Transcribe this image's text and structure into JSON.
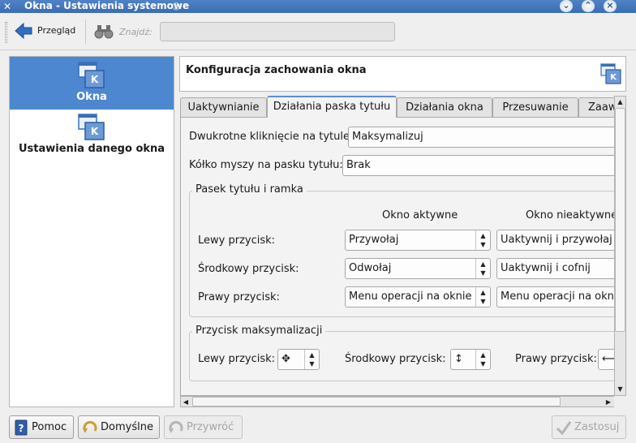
{
  "window": {
    "title": "Okna - Ustawienia systemowe"
  },
  "toolbar": {
    "back_label": "Przegląd",
    "find_label": "Znajdź:",
    "find_value": ""
  },
  "sidebar": {
    "items": [
      {
        "label": "Okna",
        "icon": "window-settings-icon"
      },
      {
        "label": "Ustawienia danego okna",
        "icon": "window-specific-icon"
      }
    ]
  },
  "header": {
    "title": "Konfiguracja zachowania okna"
  },
  "tabs": [
    {
      "label": "Uaktywnianie",
      "active": false
    },
    {
      "label": "Działania paska tytułu",
      "active": true
    },
    {
      "label": "Działania okna",
      "active": false
    },
    {
      "label": "Przesuwanie",
      "active": false
    },
    {
      "label": "Zaaw",
      "active": false
    }
  ],
  "titlebar_actions": {
    "double_click_label": "Dwukrotne kliknięcie na tytule:",
    "double_click_value": "Maksymalizuj",
    "wheel_label": "Kółko myszy na pasku tytułu:",
    "wheel_value": "Brak"
  },
  "titlebar_frame_group": {
    "title": "Pasek tytułu i ramka",
    "col_active": "Okno aktywne",
    "col_inactive": "Okno nieaktywne",
    "rows": [
      {
        "label": "Lewy przycisk:",
        "active": "Przywołaj",
        "inactive": "Uaktywnij i przywołaj"
      },
      {
        "label": "Środkowy przycisk:",
        "active": "Odwołaj",
        "inactive": "Uaktywnij i cofnij"
      },
      {
        "label": "Prawy przycisk:",
        "active": "Menu operacji na oknie",
        "inactive": "Menu operacji na oknie"
      }
    ]
  },
  "maximize_group": {
    "title": "Przycisk maksymalizacji",
    "left_label": "Lewy przycisk:",
    "left_value": "✥",
    "middle_label": "Środkowy przycisk:",
    "middle_value": "↕",
    "right_label": "Prawy przycisk:",
    "right_value": "⟷"
  },
  "buttons": {
    "help": "Pomoc",
    "defaults": "Domyślne",
    "reset": "Przywróć",
    "apply": "Zastosuj"
  },
  "colors": {
    "selection": "#4d87d0",
    "titlebar": "#3b6db0",
    "tab_accent": "#5b8fd3"
  }
}
